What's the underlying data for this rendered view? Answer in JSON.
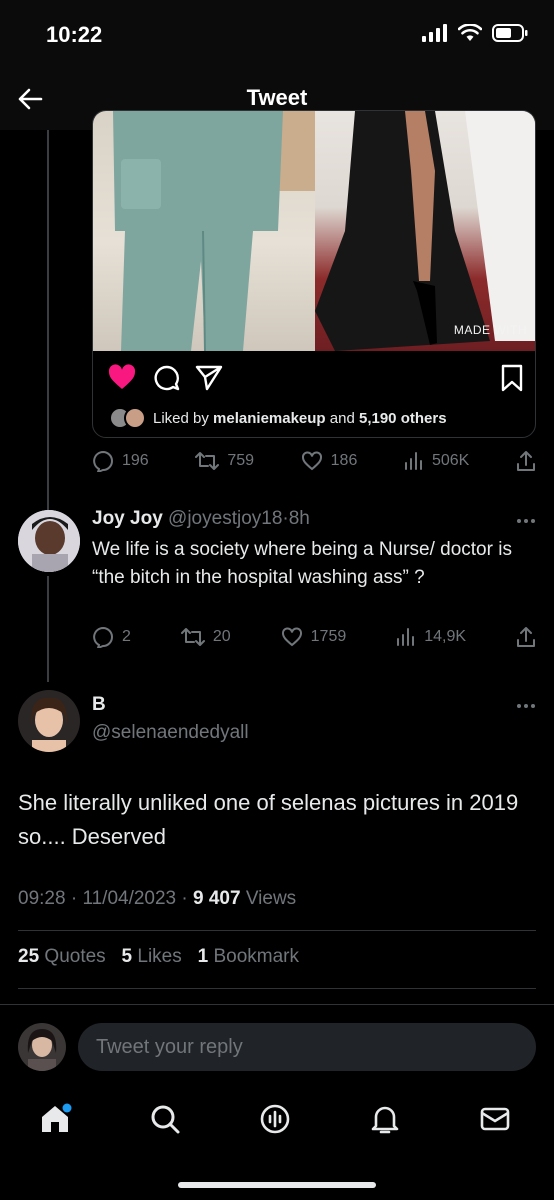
{
  "status_bar": {
    "time": "10:22"
  },
  "header": {
    "title": "Tweet"
  },
  "embed": {
    "watermark": "MADE WITH",
    "liked_prefix": "Liked by",
    "liked_user": "melaniemakeup",
    "liked_mid": "and",
    "liked_count": "5,190 others"
  },
  "quoted_metrics": {
    "replies": "196",
    "retweets": "759",
    "likes": "186",
    "views": "506K"
  },
  "reply": {
    "name": "Joy Joy",
    "handle": "@joyestjoy18",
    "time": "8h",
    "text": "We life is a society where being a Nurse/ doctor is “the bitch in the hospital washing ass” ?",
    "metrics": {
      "replies": "2",
      "retweets": "20",
      "likes": "1759",
      "views": "14,9K"
    }
  },
  "main_tweet": {
    "name": "B",
    "handle": "@selenaendedyall",
    "text": "She literally unliked one of selenas pictures in 2019 so.... Deserved",
    "time": "09:28",
    "date": "11/04/2023",
    "views_count": "9 407",
    "views_label": "Views",
    "quotes_count": "25",
    "quotes_label": "Quotes",
    "likes_count": "5",
    "likes_label": "Likes",
    "bookmarks_count": "1",
    "bookmarks_label": "Bookmark"
  },
  "reply_bar": {
    "placeholder": "Tweet your reply"
  },
  "colors": {
    "accent": "#1d9bf0",
    "heart": "#f91880",
    "muted": "#71767b",
    "text": "#e7e9ea"
  }
}
